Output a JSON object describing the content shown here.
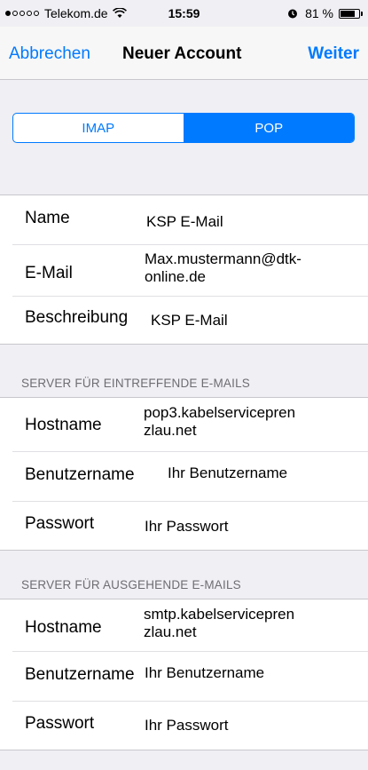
{
  "status_bar": {
    "signal_dots": [
      true,
      false,
      false,
      false,
      false
    ],
    "carrier": "Telekom.de",
    "wifi_icon": "wifi-icon",
    "time": "15:59",
    "alarm_icon": "alarm-icon",
    "battery_text": "81 %",
    "battery_level": 0.81
  },
  "nav": {
    "cancel": "Abbrechen",
    "title": "Neuer Account",
    "next": "Weiter"
  },
  "segmented": {
    "options": [
      "IMAP",
      "POP"
    ],
    "selected": "POP"
  },
  "account": {
    "name_label": "Name",
    "name_value": "KSP E-Mail",
    "email_label": "E-Mail",
    "email_value_line1": "Max.mustermann@dtk-",
    "email_value_line2": "online.de",
    "description_label": "Beschreibung",
    "description_value": "KSP E-Mail"
  },
  "incoming": {
    "header": "SERVER FÜR EINTREFFENDE E-MAILS",
    "host_label": "Hostname",
    "host_value_line1": "pop3.kabelservicepren",
    "host_value_line2": "zlau.net",
    "user_label": "Benutzername",
    "user_value": "Ihr Benutzername",
    "password_label": "Passwort",
    "password_value": "Ihr Passwort"
  },
  "outgoing": {
    "header": "SERVER FÜR AUSGEHENDE E-MAILS",
    "host_label": "Hostname",
    "host_value_line1": "smtp.kabelservicepren",
    "host_value_line2": "zlau.net",
    "user_label": "Benutzername",
    "user_value": "Ihr Benutzername",
    "password_label": "Passwort",
    "password_value": "Ihr Passwort"
  }
}
